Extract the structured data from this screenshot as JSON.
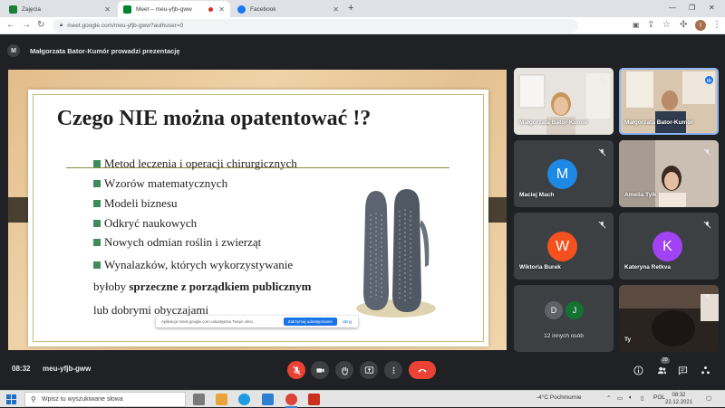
{
  "browser": {
    "tabs": [
      {
        "title": "Zajęcia",
        "active": false,
        "favicon_color": "#188038"
      },
      {
        "title": "Meet – meu-yfjb-gww",
        "active": true,
        "favicon_color": "#00832d"
      },
      {
        "title": "Facebook",
        "active": false,
        "favicon_color": "#1877f2"
      }
    ],
    "url": "meet.google.com/meu-yfjb-gww?authuser=0",
    "profile_initial": "I"
  },
  "meet": {
    "presenter_initial": "M",
    "presenter_banner": "Małgorzata Bator-Kumór prowadzi prezentację",
    "slide": {
      "title": "Czego NIE można opatentować !?",
      "bullets": [
        "Metod leczenia i operacji chirurgicznych",
        "Wzorów matematycznych",
        "Modeli biznesu",
        "Odkryć naukowych",
        "Nowych odmian roślin i zwierząt",
        "Wynalazków, których wykorzystywanie"
      ],
      "continuation_1_plain": "byłoby ",
      "continuation_1_bold": "sprzeczne z porządkiem publicznym",
      "continuation_2": "lub dobrymi obyczajami",
      "accent_color": "#3f8c5a"
    },
    "notice": {
      "message": "Aplikacja meet.google.com udostępnia Twoje okno.",
      "primary_button": "Zatrzymaj udostępnianie",
      "secondary_button": "Ukryj"
    },
    "participants": [
      {
        "name": "Małgorzata Bator-Kumór",
        "type": "video",
        "speaking": false
      },
      {
        "name": "Małgorzata Bator-Kumór",
        "type": "video",
        "speaking": true
      },
      {
        "name": "Maciej Mach",
        "type": "avatar",
        "initial": "M",
        "color": "#1e88e5"
      },
      {
        "name": "Amelia Tylk",
        "type": "video"
      },
      {
        "name": "Wiktoria Burek",
        "type": "avatar",
        "initial": "W",
        "color": "#f4511e"
      },
      {
        "name": "Kateryna Retkva",
        "type": "avatar",
        "initial": "K",
        "color": "#a142f4"
      },
      {
        "name": "12 innych osób",
        "type": "group",
        "initials": [
          "D",
          "J"
        ]
      },
      {
        "name": "Ty",
        "type": "video"
      }
    ],
    "time": "08:32",
    "meeting_code": "meu-yfjb-gww",
    "participants_badge": "20",
    "end_call_color": "#ea4335"
  },
  "taskbar": {
    "search_placeholder": "Wpisz tu wyszukiwane słowa",
    "weather": "-4°C Pochmurnie",
    "language": "POL",
    "clock_time": "08:32",
    "clock_date": "22.12.2021"
  }
}
